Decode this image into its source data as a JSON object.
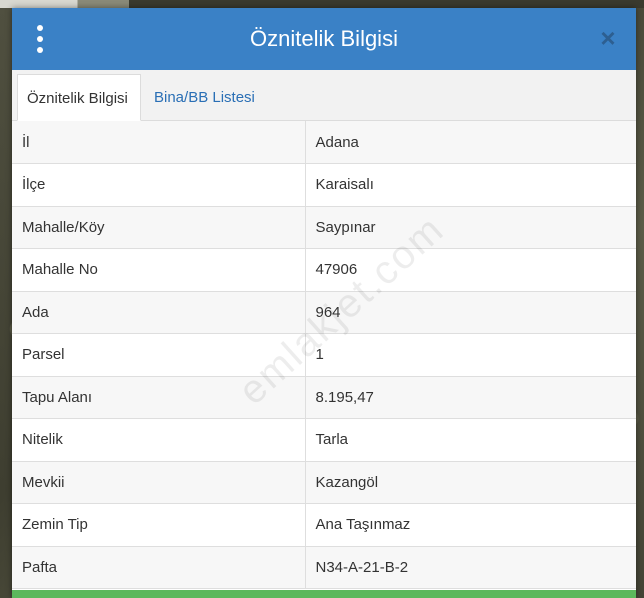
{
  "dialog": {
    "title": "Öznitelik Bilgisi",
    "close_label": "×"
  },
  "tabs": [
    {
      "label": "Öznitelik Bilgisi",
      "active": true
    },
    {
      "label": "Bina/BB Listesi",
      "active": false
    }
  ],
  "attributes": [
    {
      "key": "İl",
      "value": "Adana"
    },
    {
      "key": "İlçe",
      "value": "Karaisalı"
    },
    {
      "key": "Mahalle/Köy",
      "value": "Saypınar"
    },
    {
      "key": "Mahalle No",
      "value": "47906"
    },
    {
      "key": "Ada",
      "value": "964"
    },
    {
      "key": "Parsel",
      "value": "1"
    },
    {
      "key": "Tapu Alanı",
      "value": "8.195,47"
    },
    {
      "key": "Nitelik",
      "value": "Tarla"
    },
    {
      "key": "Mevkii",
      "value": "Kazangöl"
    },
    {
      "key": "Zemin Tip",
      "value": "Ana Taşınmaz"
    },
    {
      "key": "Pafta",
      "value": "N34-A-21-B-2"
    }
  ],
  "watermark": "emlakjet.com",
  "colors": {
    "header": "#3a81c6",
    "tab_link": "#2a6fb5",
    "footer_bar": "#5cb85c"
  }
}
